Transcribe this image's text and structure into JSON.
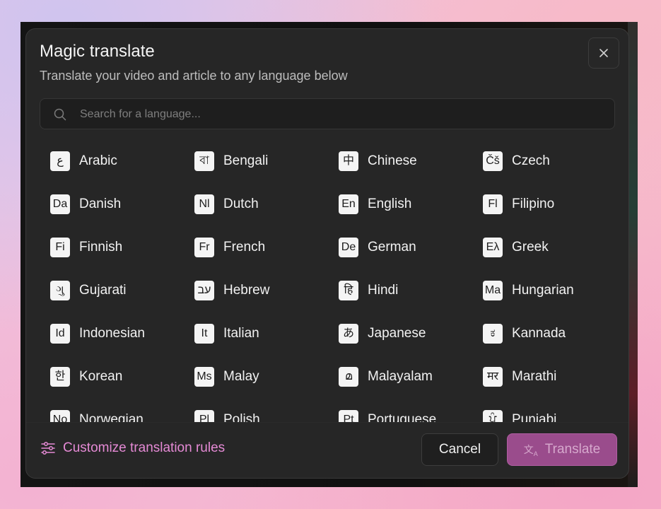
{
  "dialog": {
    "title": "Magic translate",
    "subtitle": "Translate your video and article to any language below"
  },
  "search": {
    "placeholder": "Search for a language..."
  },
  "languages": [
    {
      "badge": "ع",
      "name": "Arabic"
    },
    {
      "badge": "বা",
      "name": "Bengali"
    },
    {
      "badge": "中",
      "name": "Chinese"
    },
    {
      "badge": "Čš",
      "name": "Czech"
    },
    {
      "badge": "Da",
      "name": "Danish"
    },
    {
      "badge": "Nl",
      "name": "Dutch"
    },
    {
      "badge": "En",
      "name": "English"
    },
    {
      "badge": "Fl",
      "name": "Filipino"
    },
    {
      "badge": "Fi",
      "name": "Finnish"
    },
    {
      "badge": "Fr",
      "name": "French"
    },
    {
      "badge": "De",
      "name": "German"
    },
    {
      "badge": "Eλ",
      "name": "Greek"
    },
    {
      "badge": "ગુ",
      "name": "Gujarati"
    },
    {
      "badge": "עב",
      "name": "Hebrew"
    },
    {
      "badge": "हि",
      "name": "Hindi"
    },
    {
      "badge": "Ma",
      "name": "Hungarian"
    },
    {
      "badge": "Id",
      "name": "Indonesian"
    },
    {
      "badge": "It",
      "name": "Italian"
    },
    {
      "badge": "あ",
      "name": "Japanese"
    },
    {
      "badge": "ಕ",
      "name": "Kannada"
    },
    {
      "badge": "한",
      "name": "Korean"
    },
    {
      "badge": "Ms",
      "name": "Malay"
    },
    {
      "badge": "മ",
      "name": "Malayalam"
    },
    {
      "badge": "मर",
      "name": "Marathi"
    },
    {
      "badge": "No",
      "name": "Norwegian"
    },
    {
      "badge": "Pl",
      "name": "Polish"
    },
    {
      "badge": "Pt",
      "name": "Portuguese"
    },
    {
      "badge": "ਪੰ",
      "name": "Punjabi"
    }
  ],
  "footer": {
    "customize_label": "Customize translation rules",
    "cancel_label": "Cancel",
    "translate_label": "Translate"
  },
  "colors": {
    "accent": "#e58ad5",
    "primary_button": "#9a4c8c",
    "dialog_bg": "#262626"
  },
  "icons": {
    "close": "close-icon",
    "search": "search-icon",
    "customize": "sliders-icon",
    "translate": "translate-icon"
  }
}
